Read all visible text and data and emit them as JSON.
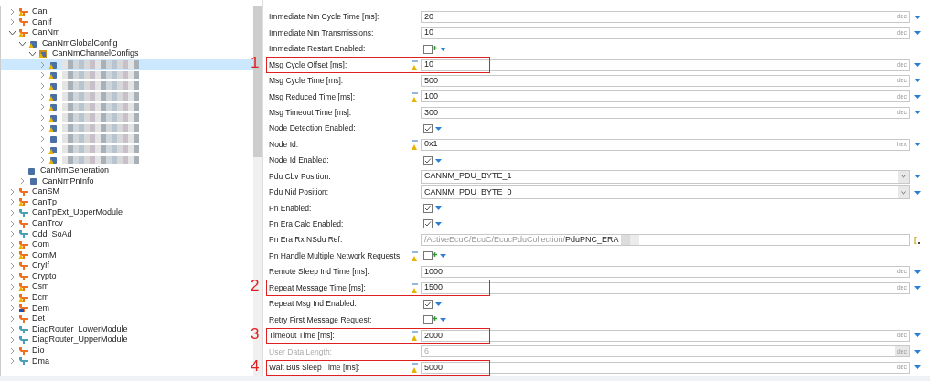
{
  "tree": {
    "items": [
      {
        "label": "Can",
        "kind": "module",
        "warning": true,
        "expanded": false
      },
      {
        "label": "CanIf",
        "kind": "module",
        "warning": false,
        "expanded": false
      },
      {
        "label": "CanNm",
        "kind": "module",
        "warning": true,
        "expanded": true,
        "children": [
          {
            "label": "CanNmGlobalConfig",
            "kind": "container",
            "warning": true,
            "expanded": true,
            "children": [
              {
                "label": "CanNmChannelConfigs",
                "kind": "folder",
                "warning": true,
                "expanded": true,
                "children": [
                  {
                    "kind": "redacted",
                    "warning": true,
                    "expanded": false,
                    "selected": true
                  },
                  {
                    "kind": "redacted",
                    "warning": true,
                    "expanded": false,
                    "selected": false
                  },
                  {
                    "kind": "redacted",
                    "warning": true,
                    "expanded": false,
                    "selected": false
                  },
                  {
                    "kind": "redacted",
                    "warning": true,
                    "expanded": false,
                    "selected": false
                  },
                  {
                    "kind": "redacted",
                    "warning": true,
                    "expanded": false,
                    "selected": false
                  },
                  {
                    "kind": "redacted",
                    "warning": true,
                    "expanded": false,
                    "selected": false
                  },
                  {
                    "kind": "redacted",
                    "warning": true,
                    "expanded": false,
                    "selected": false
                  },
                  {
                    "kind": "redacted",
                    "warning": false,
                    "expanded": false,
                    "selected": false
                  },
                  {
                    "kind": "redacted",
                    "warning": true,
                    "expanded": false,
                    "selected": false
                  },
                  {
                    "kind": "redacted",
                    "warning": true,
                    "expanded": false,
                    "selected": false
                  }
                ]
              }
            ]
          },
          {
            "label": "CanNmGeneration",
            "kind": "container",
            "warning": false,
            "leaf": true
          },
          {
            "label": "CanNmPnInfo",
            "kind": "container",
            "warning": false,
            "expanded": false
          }
        ]
      },
      {
        "label": "CanSM",
        "kind": "module",
        "warning": false,
        "expanded": false
      },
      {
        "label": "CanTp",
        "kind": "module",
        "warning": true,
        "expanded": false
      },
      {
        "label": "CanTpExt_UpperModule",
        "kind": "ext-module",
        "warning": false,
        "expanded": false
      },
      {
        "label": "CanTrcv",
        "kind": "module",
        "warning": false,
        "expanded": false
      },
      {
        "label": "Cdd_SoAd",
        "kind": "ext-module",
        "warning": false,
        "expanded": false
      },
      {
        "label": "Com",
        "kind": "module",
        "warning": true,
        "expanded": false
      },
      {
        "label": "ComM",
        "kind": "module",
        "warning": true,
        "expanded": false
      },
      {
        "label": "CryIf",
        "kind": "module",
        "warning": false,
        "expanded": false
      },
      {
        "label": "Crypto",
        "kind": "module",
        "warning": false,
        "expanded": false
      },
      {
        "label": "Csm",
        "kind": "module",
        "warning": true,
        "expanded": false
      },
      {
        "label": "Dcm",
        "kind": "module",
        "warning": true,
        "expanded": false
      },
      {
        "label": "Dem",
        "kind": "module",
        "warning": false,
        "locked": true,
        "expanded": false
      },
      {
        "label": "Det",
        "kind": "module",
        "warning": false,
        "expanded": false
      },
      {
        "label": "DiagRouter_LowerModule",
        "kind": "ext-module",
        "warning": false,
        "expanded": false
      },
      {
        "label": "DiagRouter_UpperModule",
        "kind": "ext-module",
        "warning": false,
        "expanded": false
      },
      {
        "label": "Dio",
        "kind": "module",
        "warning": false,
        "expanded": false
      },
      {
        "label": "Dma",
        "kind": "ext-module",
        "warning": false,
        "expanded": false
      }
    ]
  },
  "params": [
    {
      "kind": "number",
      "label": "Immediate Nm Cycle Time [ms]:",
      "value": "20",
      "unit": "dec",
      "warning": false
    },
    {
      "kind": "number",
      "label": "Immediate Nm Transmissions:",
      "value": "10",
      "unit": "dec",
      "warning": false
    },
    {
      "kind": "checkbox",
      "label": "Immediate Restart Enabled:",
      "checked": false,
      "warning": false
    },
    {
      "kind": "number",
      "label": "Msg Cycle Offset [ms]:",
      "value": "10",
      "unit": "dec",
      "warning": true,
      "annotation": "1"
    },
    {
      "kind": "number",
      "label": "Msg Cycle Time [ms]:",
      "value": "500",
      "unit": "dec",
      "warning": false
    },
    {
      "kind": "number",
      "label": "Msg Reduced Time [ms]:",
      "value": "100",
      "unit": "dec",
      "warning": true
    },
    {
      "kind": "number",
      "label": "Msg Timeout Time [ms]:",
      "value": "300",
      "unit": "dec",
      "warning": false
    },
    {
      "kind": "checkbox",
      "label": "Node Detection Enabled:",
      "checked": true,
      "warning": false
    },
    {
      "kind": "number",
      "label": "Node Id:",
      "value": "0x1",
      "unit": "hex",
      "warning": true
    },
    {
      "kind": "checkbox",
      "label": "Node Id Enabled:",
      "checked": true,
      "warning": false
    },
    {
      "kind": "select",
      "label": "Pdu Cbv Position:",
      "value": "CANNM_PDU_BYTE_1"
    },
    {
      "kind": "select",
      "label": "Pdu Nid Position:",
      "value": "CANNM_PDU_BYTE_0"
    },
    {
      "kind": "checkbox",
      "label": "Pn Enabled:",
      "checked": true,
      "warning": false
    },
    {
      "kind": "checkbox",
      "label": "Pn Era Calc Enabled:",
      "checked": true,
      "warning": false
    },
    {
      "kind": "reference",
      "label": "Pn Era Rx NSdu Ref:",
      "path": "/ActiveEcuC/EcuC/EcucPduCollection/",
      "target": "PduPNC_ERA"
    },
    {
      "kind": "checkbox",
      "label": "Pn Handle Multiple Network Requests:",
      "checked": false,
      "warning": true
    },
    {
      "kind": "number",
      "label": "Remote Sleep Ind Time [ms]:",
      "value": "1000",
      "unit": "dec",
      "warning": false
    },
    {
      "kind": "number",
      "label": "Repeat Message Time [ms]:",
      "value": "1500",
      "unit": "dec",
      "warning": true,
      "annotation": "2"
    },
    {
      "kind": "checkbox",
      "label": "Repeat Msg Ind Enabled:",
      "checked": true,
      "warning": false
    },
    {
      "kind": "checkbox",
      "label": "Retry First Message Request:",
      "checked": false,
      "warning": false
    },
    {
      "kind": "number",
      "label": "Timeout Time [ms]:",
      "value": "2000",
      "unit": "dec",
      "warning": true,
      "annotation": "3"
    },
    {
      "kind": "number",
      "label": "User Data Length:",
      "value": "6",
      "unit": "dec",
      "warning": false,
      "disabled": true
    },
    {
      "kind": "number",
      "label": "Wait Bus Sleep Time [ms]:",
      "value": "5000",
      "unit": "dec",
      "warning": true,
      "annotation": "4"
    }
  ]
}
